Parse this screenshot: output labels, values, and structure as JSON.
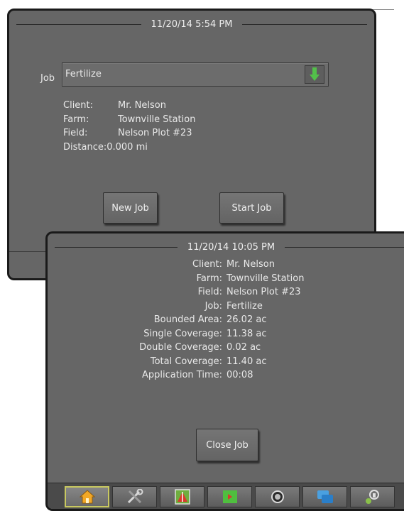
{
  "job_setup_screen": {
    "datetime": "11/20/14 5:54 PM",
    "job_label": "Job",
    "job_value": "Fertilize",
    "details": [
      {
        "label": "Client:",
        "value": "Mr. Nelson"
      },
      {
        "label": "Farm:",
        "value": "Townville Station"
      },
      {
        "label": "Field:",
        "value": "Nelson Plot #23"
      },
      {
        "label": "Distance:",
        "value": "0.000 mi"
      }
    ],
    "new_job_label": "New Job",
    "start_job_label": "Start Job"
  },
  "job_summary_screen": {
    "datetime": "11/20/14 10:05 PM",
    "details": [
      {
        "label": "Client:",
        "value": "Mr. Nelson"
      },
      {
        "label": "Farm:",
        "value": "Townville Station"
      },
      {
        "label": "Field:",
        "value": "Nelson Plot #23"
      },
      {
        "label": "Job:",
        "value": "Fertilize"
      },
      {
        "label": "Bounded Area:",
        "value": "26.02 ac"
      },
      {
        "label": "Single Coverage:",
        "value": "11.38 ac"
      },
      {
        "label": "Double Coverage:",
        "value": "0.02 ac"
      },
      {
        "label": "Total Coverage:",
        "value": "11.40 ac"
      },
      {
        "label": "Application Time:",
        "value": "00:08"
      }
    ],
    "close_job_label": "Close Job"
  },
  "tabs": [
    {
      "icon": "home-icon",
      "active": true
    },
    {
      "icon": "tools-icon",
      "active": false
    },
    {
      "icon": "guidance-icon",
      "active": false
    },
    {
      "icon": "map-icon",
      "active": false
    },
    {
      "icon": "rate-control-icon",
      "active": false
    },
    {
      "icon": "data-icon",
      "active": false
    },
    {
      "icon": "settings-icon",
      "active": false
    }
  ],
  "colors": {
    "panel": "#666666",
    "accent_green": "#4caf50",
    "active_tab_border": "#c8c860"
  }
}
